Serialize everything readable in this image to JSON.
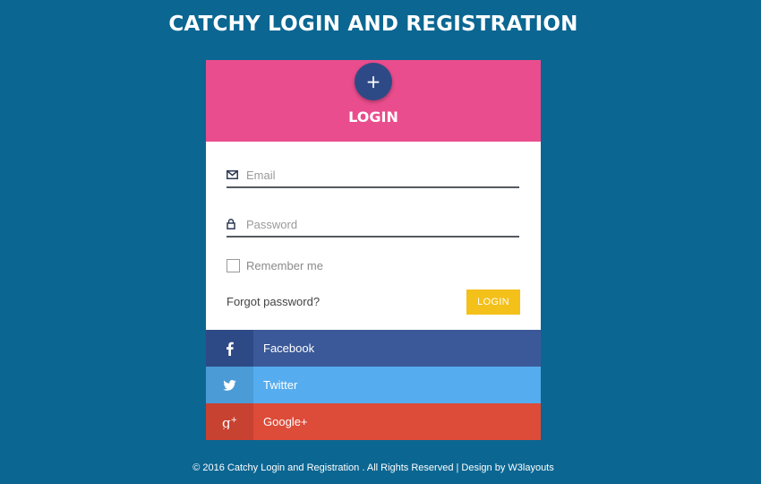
{
  "page": {
    "title": "CATCHY LOGIN AND REGISTRATION"
  },
  "card": {
    "header_title": "LOGIN",
    "plus_symbol": "+",
    "email_placeholder": "Email",
    "password_placeholder": "Password",
    "remember_label": "Remember me",
    "forgot_label": "Forgot password?",
    "login_button": "LOGIN"
  },
  "social": [
    {
      "label": "Facebook",
      "icon": "facebook-icon"
    },
    {
      "label": "Twitter",
      "icon": "twitter-icon"
    },
    {
      "label": "Google+",
      "icon": "google-plus-icon"
    }
  ],
  "footer": {
    "text": "© 2016 Catchy Login and Registration . All Rights Reserved | Design by W3layouts"
  },
  "colors": {
    "background": "#0b6692",
    "header": "#ea4d8d",
    "accent_button": "#f4c01a",
    "facebook": "#3b5998",
    "twitter": "#55acee",
    "google": "#dd4b39"
  }
}
